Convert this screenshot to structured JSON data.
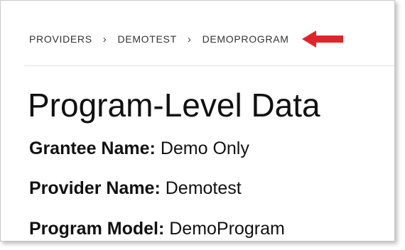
{
  "breadcrumb": {
    "items": [
      "PROVIDERS",
      "DEMOTEST",
      "DEMOPROGRAM"
    ],
    "separator": "›",
    "arrow_icon": "red-left-arrow-icon",
    "arrow_color": "#e0252a"
  },
  "page": {
    "title": "Program-Level Data"
  },
  "fields": {
    "grantee": {
      "label": "Grantee Name:",
      "value": "Demo Only"
    },
    "provider": {
      "label": "Provider Name:",
      "value": "Demotest"
    },
    "program": {
      "label": "Program Model:",
      "value": "DemoProgram"
    }
  }
}
